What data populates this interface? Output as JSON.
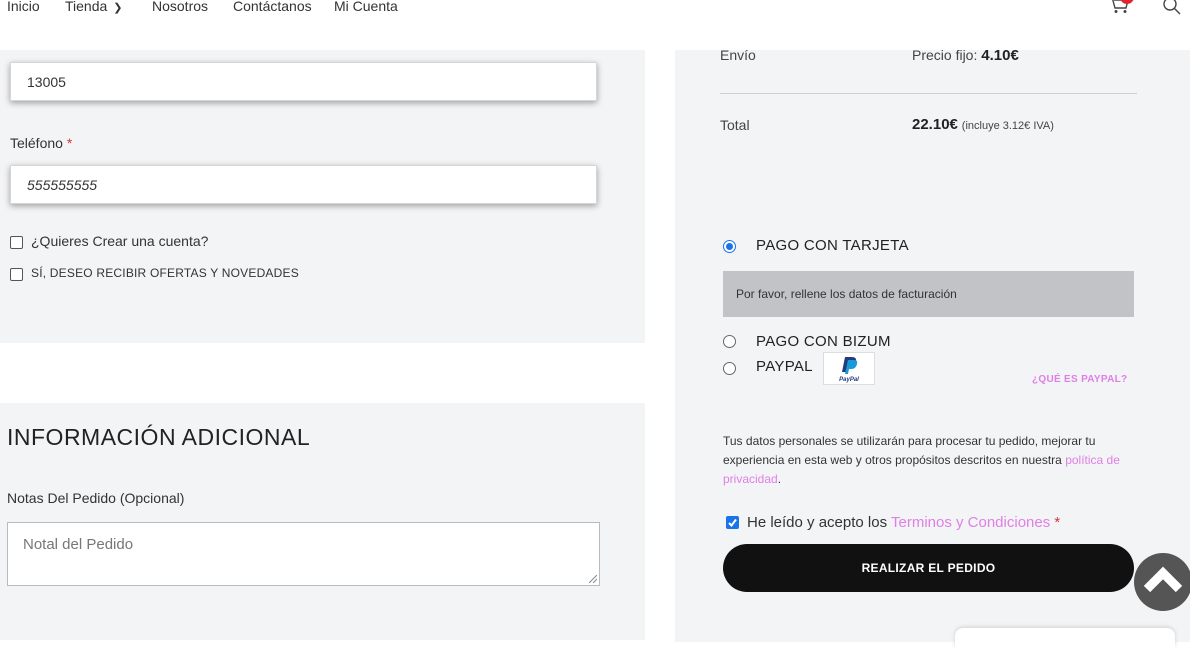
{
  "nav": {
    "items": [
      "Inicio",
      "Tienda",
      "Nosotros",
      "Contáctanos",
      "Mi Cuenta"
    ]
  },
  "billing": {
    "postcode_value": "13005",
    "phone_label": "Teléfono",
    "required_mark": "*",
    "phone_value": "555555555",
    "create_account_label": "¿Quieres Crear una cuenta?",
    "offers_label": "SÍ, DESEO RECIBIR OFERTAS Y NOVEDADES"
  },
  "additional": {
    "title": "INFORMACIÓN ADICIONAL",
    "notes_label": "Notas Del Pedido (Opcional)",
    "notes_placeholder": "Notal del Pedido"
  },
  "summary": {
    "shipping_label": "Envío",
    "shipping_method": "Precio fijo:",
    "shipping_price": "4.10€",
    "total_label": "Total",
    "total_value": "22.10€",
    "total_tax": "(incluye 3.12€ IVA)"
  },
  "payment": {
    "card_label": "PAGO CON TARJETA",
    "card_message": "Por favor, rellene los datos de facturación",
    "bizum_label": "PAGO CON BIZUM",
    "paypal_label": "PAYPAL",
    "paypal_logo_text": "PayPal",
    "what_is_paypal": "¿QUÉ ES PAYPAL?",
    "selected": "card"
  },
  "privacy": {
    "text": "Tus datos personales se utilizarán para procesar tu pedido, mejorar tu experiencia en esta web y otros propósitos descritos en nuestra ",
    "link": "política de privacidad",
    "end": "."
  },
  "terms": {
    "prefix": "He leído y acepto los ",
    "link": "Terminos y Condiciones",
    "required_mark": "*",
    "checked": true
  },
  "order_button": "REALIZAR EL PEDIDO",
  "colors": {
    "accent_link": "#e07fe6",
    "button_bg": "#111111",
    "panel_bg": "#f3f4f6",
    "required": "#d63638"
  }
}
